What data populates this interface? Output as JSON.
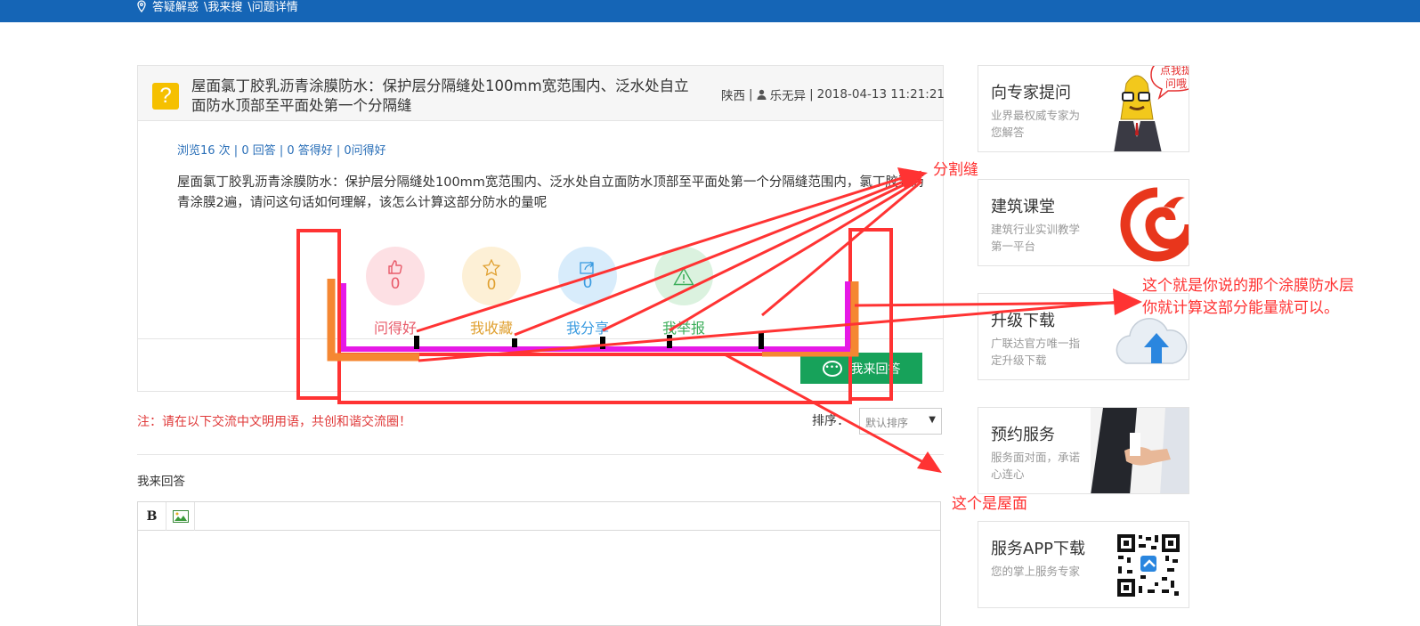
{
  "header": {
    "breadcrumb": [
      "答疑解惑",
      "\\我来搜",
      "\\问题详情"
    ]
  },
  "question": {
    "icon": "question-mark-icon",
    "title": "屋面氯丁胶乳沥青涂膜防水：保护层分隔缝处100mm宽范围内、泛水处自立面防水顶部至平面处第一个分隔缝",
    "region": "陕西",
    "separator": "|",
    "author": "乐无异",
    "datetime": "2018-04-13 11:21:21",
    "stats": "浏览16 次 | 0 回答 | 0 答得好 | 0问得好",
    "body": "屋面氯丁胶乳沥青涂膜防水：保护层分隔缝处100mm宽范围内、泛水处自立面防水顶部至平面处第一个分隔缝范围内，氯丁胶乳沥青涂膜2遍，请问这句话如何理解，该怎么计算这部分防水的量呢",
    "actions": [
      {
        "icon": "thumbs-up-icon",
        "count": "0",
        "label": "问得好",
        "color": "#e85b6a",
        "bg": "#fde0e4"
      },
      {
        "icon": "star-icon",
        "count": "0",
        "label": "我收藏",
        "color": "#e0a030",
        "bg": "#fdf0d6"
      },
      {
        "icon": "share-icon",
        "count": "0",
        "label": "我分享",
        "color": "#3a9be0",
        "bg": "#d8ecfb"
      },
      {
        "icon": "warning-icon",
        "count": "",
        "label": "我举报",
        "color": "#3cae5a",
        "bg": "#dbf2df"
      }
    ],
    "answer_button": "我来回答"
  },
  "discussion": {
    "notice": "注：请在以下交流中文明用语，共创和谐交流圈！",
    "sort_label": "排序：",
    "sort_value": "默认排序",
    "my_answer_label": "我来回答",
    "toolbar": {
      "bold": "B",
      "image_icon": "image-icon"
    }
  },
  "sidebar": [
    {
      "title": "向专家提问",
      "desc": "业界最权威专家为您解答",
      "icon": "expert-mascot-icon",
      "badge": "点我提问哦"
    },
    {
      "title": "建筑课堂",
      "desc": "建筑行业实训教学第一平台",
      "icon": "classroom-logo-icon"
    },
    {
      "title": "升级下载",
      "desc": "广联达官方唯一指定升级下载",
      "icon": "cloud-upload-icon"
    },
    {
      "title": "预约服务",
      "desc": "服务面对面，承诺心连心",
      "icon": "handshake-icon"
    },
    {
      "title": "服务APP下载",
      "desc": "您的掌上服务专家",
      "icon": "qr-code-icon"
    }
  ],
  "annotations": {
    "joint": "分割缝",
    "membrane_line1": "这个就是你说的那个涂膜防水层",
    "membrane_line2": "你就计算这部分能量就可以。",
    "roof": "这个是屋面"
  },
  "colors": {
    "header_blue": "#1565b6",
    "annotation_red": "#ff3030",
    "magenta": "#e619e6",
    "orange": "#f58732",
    "green_button": "#17a25a"
  }
}
